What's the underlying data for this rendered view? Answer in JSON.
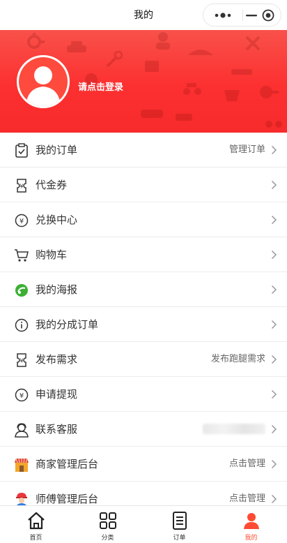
{
  "nav": {
    "title": "我的"
  },
  "profile": {
    "login_prompt": "请点击登录"
  },
  "menu": [
    {
      "label": "我的订单",
      "right": "管理订单",
      "icon": "checklist-icon"
    },
    {
      "label": "代金券",
      "right": "",
      "icon": "voucher-icon"
    },
    {
      "label": "兑换中心",
      "right": "",
      "icon": "yen-coin-icon"
    },
    {
      "label": "购物车",
      "right": "",
      "icon": "cart-icon"
    },
    {
      "label": "我的海报",
      "right": "",
      "icon": "poster-icon"
    },
    {
      "label": "我的分成订单",
      "right": "",
      "icon": "info-icon"
    },
    {
      "label": "发布需求",
      "right": "发布跑腿需求",
      "icon": "voucher-icon"
    },
    {
      "label": "申请提现",
      "right": "",
      "icon": "yen-coin-icon"
    },
    {
      "label": "联系客服",
      "right": "",
      "icon": "customer-service-icon"
    },
    {
      "label": "商家管理后台",
      "right": "点击管理",
      "icon": "shop-icon"
    },
    {
      "label": "师傅管理后台",
      "right": "点击管理",
      "icon": "worker-icon"
    }
  ],
  "tabbar": [
    {
      "label": "首页",
      "icon": "home-icon",
      "active": false
    },
    {
      "label": "分类",
      "icon": "category-icon",
      "active": false
    },
    {
      "label": "订单",
      "icon": "order-icon",
      "active": false
    },
    {
      "label": "我的",
      "icon": "profile-icon",
      "active": true
    }
  ],
  "colors": {
    "accent": "#fc3030",
    "active_tab": "#ff4b33"
  }
}
